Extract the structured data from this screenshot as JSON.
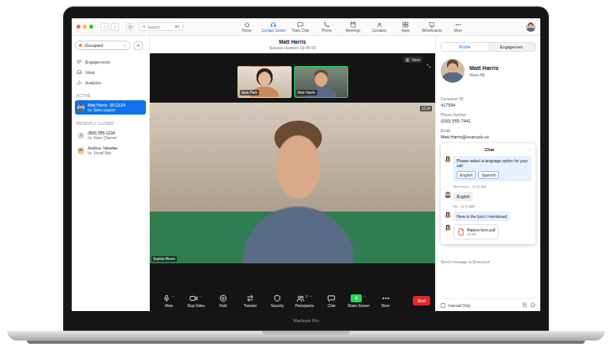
{
  "device": {
    "label": "Macbook Pro"
  },
  "toolbar": {
    "search": {
      "placeholder": "Search",
      "shortcut": "⌘F"
    },
    "nav": [
      {
        "label": "Home",
        "kind": "home",
        "selected": false
      },
      {
        "label": "Contact Center",
        "kind": "headset",
        "selected": true
      },
      {
        "label": "Team Chat",
        "kind": "chat",
        "selected": false
      },
      {
        "label": "Phone",
        "kind": "phone",
        "selected": false
      },
      {
        "label": "Meetings",
        "kind": "calendar",
        "selected": false
      },
      {
        "label": "Contacts",
        "kind": "contacts",
        "selected": false
      },
      {
        "label": "Apps",
        "kind": "apps",
        "selected": false
      },
      {
        "label": "Whiteboards",
        "kind": "board",
        "selected": false
      },
      {
        "label": "More",
        "kind": "more",
        "selected": false
      }
    ]
  },
  "sidebar": {
    "status": {
      "label": "Occupied"
    },
    "add": "+",
    "menu": [
      {
        "label": "Engagements",
        "kind": "engagements"
      },
      {
        "label": "Inbox",
        "kind": "inbox"
      },
      {
        "label": "Analytics",
        "kind": "analytics"
      }
    ],
    "sections": [
      {
        "heading": "ACTIVE",
        "items": [
          {
            "name": "Matt Harris",
            "time": "00:13:24",
            "detail": "Sales support",
            "kind": "photo",
            "selected": true
          }
        ]
      },
      {
        "heading": "RECENTLY CLOSED",
        "items": [
          {
            "name": "(800) 555-1234",
            "detail": "Video Channel",
            "kind": "person",
            "selected": false
          },
          {
            "name": "Andrius Yatsefas",
            "detail": "Virtual Visit",
            "kind": "initials",
            "avatar": "AY",
            "selected": false
          }
        ]
      }
    ]
  },
  "session": {
    "title": "Matt Harris",
    "duration": "Session duration 03:45:00",
    "view": "View",
    "timer": "12:24",
    "speaker": "Sophia Moore",
    "thumbnails": [
      {
        "label": "Jane Park",
        "selected": false
      },
      {
        "label": "Matt Harris",
        "selected": true
      }
    ]
  },
  "controls": [
    {
      "label": "Mute",
      "kind": "mic",
      "caret": true
    },
    {
      "label": "Stop Video",
      "kind": "video",
      "caret": true
    },
    {
      "label": "Hold",
      "kind": "hold",
      "caret": false
    },
    {
      "label": "Transfer",
      "kind": "transfer",
      "caret": false
    },
    {
      "label": "Security",
      "kind": "shield",
      "caret": false
    },
    {
      "label": "Participants",
      "kind": "people",
      "count": "2",
      "caret": true
    },
    {
      "label": "Chat",
      "kind": "chat",
      "caret": false
    },
    {
      "label": "Share Screen",
      "kind": "share",
      "caret": true
    },
    {
      "label": "More",
      "kind": "more",
      "caret": false
    }
  ],
  "end": {
    "label": "End"
  },
  "profile": {
    "tabs": [
      {
        "label": "Profile",
        "selected": true
      },
      {
        "label": "Engagement",
        "selected": false
      }
    ],
    "name": "Matt Harris",
    "location": "West AB",
    "fields": [
      {
        "label": "Consumer ID",
        "value": "417594"
      },
      {
        "label": "Phone Number",
        "value": "(000) 555-7441"
      },
      {
        "label": "Email",
        "value": "Matt.Harris@example.co"
      }
    ]
  },
  "chat": {
    "title": "Chat",
    "menu": "···",
    "messages": [
      {
        "kind": "prompt",
        "side": "agent",
        "text": "Please select a language option for your call",
        "options": [
          "English",
          "Spanish"
        ]
      },
      {
        "kind": "text",
        "side": "customer",
        "sender": "Matt Harris",
        "time": "11:32 AM",
        "text": "English"
      },
      {
        "kind": "text",
        "side": "agent",
        "sender": "Me",
        "time": "11:32 AM",
        "text": "Here is the form I mentioned"
      },
      {
        "kind": "file",
        "side": "agent",
        "file": "Patient form.pdf",
        "size": "25 KB"
      }
    ],
    "composer": {
      "placeholder": "Send message to Everyone"
    },
    "internal_only": {
      "label": "Internal Only",
      "checked": false
    }
  }
}
